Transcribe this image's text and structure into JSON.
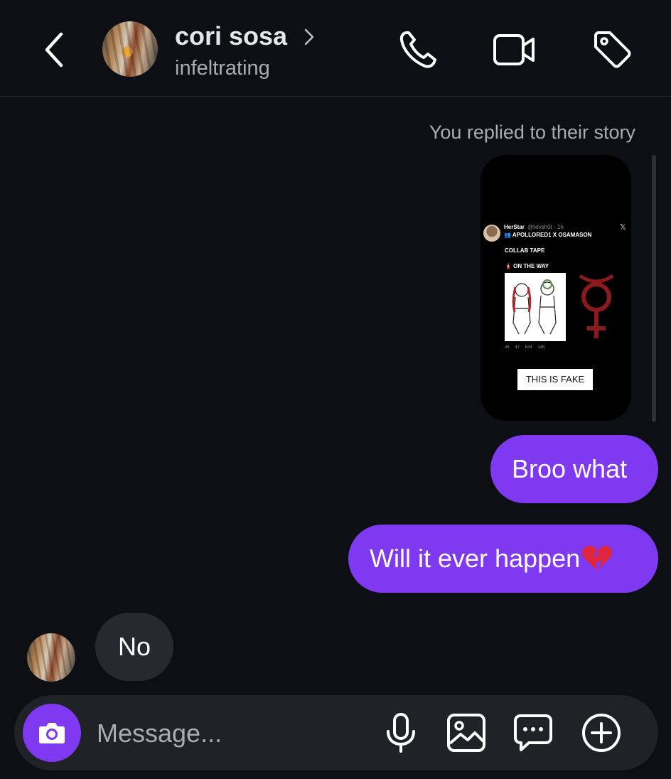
{
  "header": {
    "back_icon": "chevron-left-icon",
    "contact_name": "cori sosa",
    "contact_username": "infeltrating",
    "actions": [
      "phone-icon",
      "video-camera-icon",
      "tag-icon"
    ]
  },
  "thread": {
    "story_caption": "You replied to their story",
    "story_preview": {
      "tweet_name": "HerStar",
      "tweet_handle": "@lxlvsh0t · 1h",
      "line1": "👥 APOLLORED1 X OSAMASON",
      "line2": "COLLAB TAPE",
      "line3": "🧯 ON THE WAY",
      "stats": "45 47 644 14K",
      "overlay_label": "THIS IS FAKE"
    },
    "messages": [
      {
        "from": "me",
        "text": "Broo what"
      },
      {
        "from": "me",
        "text": "Will it ever happen",
        "emoji": "broken-heart"
      },
      {
        "from": "them",
        "text": "No"
      }
    ]
  },
  "composer": {
    "placeholder": "Message...",
    "icons": [
      "camera-icon",
      "microphone-icon",
      "gallery-icon",
      "sticker-chat-icon",
      "plus-circle-icon"
    ]
  },
  "colors": {
    "background": "#0c1014",
    "outgoing_bubble": "#7f39f0",
    "incoming_bubble": "#262a2f",
    "secondary_text": "#a8adb2"
  }
}
